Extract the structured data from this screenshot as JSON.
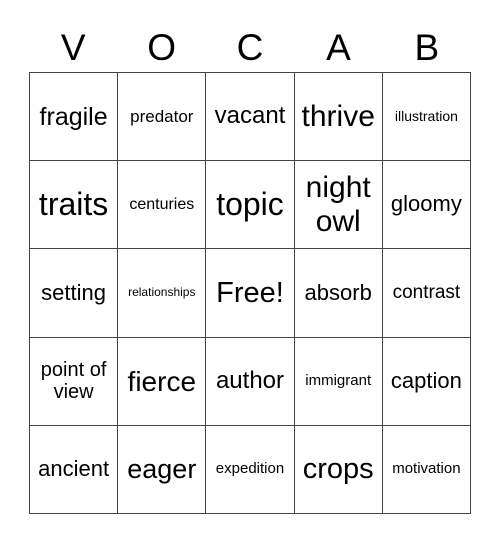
{
  "header": {
    "letters": [
      "V",
      "O",
      "C",
      "A",
      "B"
    ]
  },
  "grid": {
    "rows": [
      [
        "fragile",
        "predator",
        "vacant",
        "thrive",
        "illustration"
      ],
      [
        "traits",
        "centuries",
        "topic",
        "night owl",
        "gloomy"
      ],
      [
        "setting",
        "relationships",
        "Free!",
        "absorb",
        "contrast"
      ],
      [
        "point of view",
        "fierce",
        "author",
        "immigrant",
        "caption"
      ],
      [
        "ancient",
        "eager",
        "expedition",
        "crops",
        "motivation"
      ]
    ]
  }
}
